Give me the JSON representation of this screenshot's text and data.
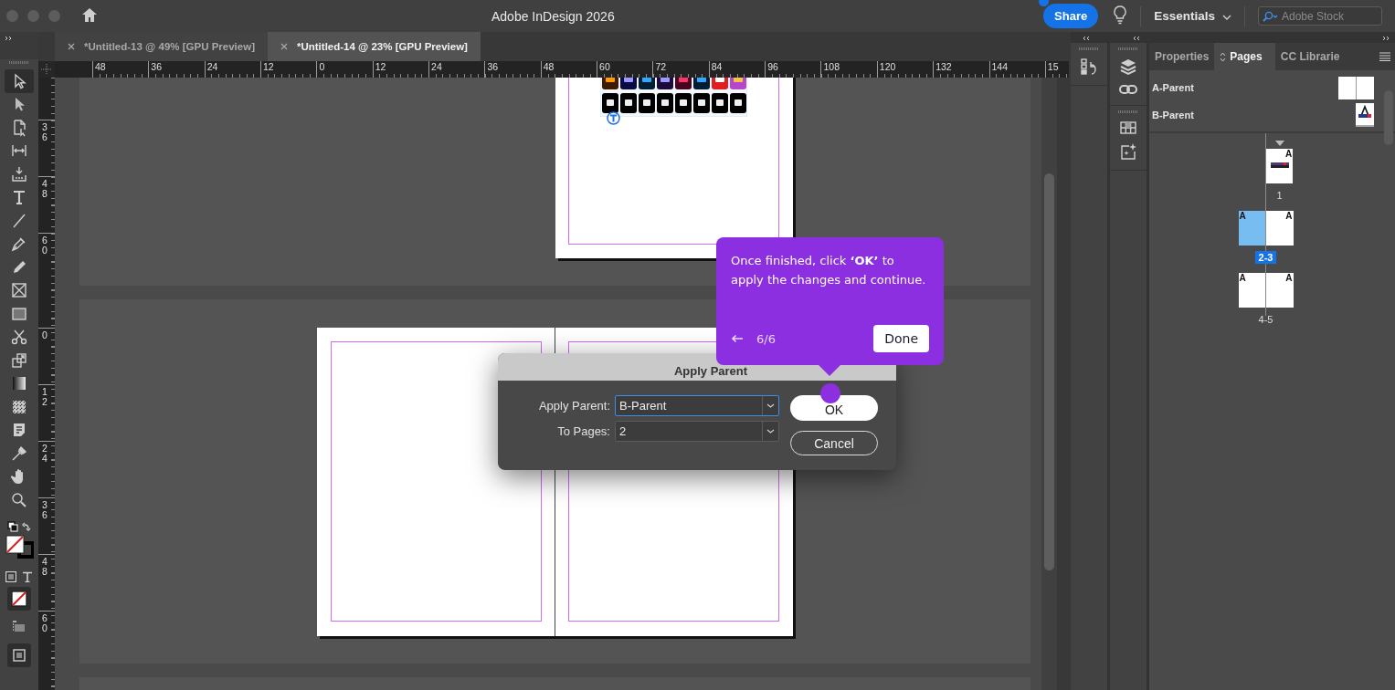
{
  "window": {
    "title": "Adobe InDesign 2026"
  },
  "header": {
    "share": "Share",
    "workspace": "Essentials",
    "search": {
      "placeholder": "Adobe Stock"
    }
  },
  "tools": [
    {
      "kind": "selection",
      "selected": true
    },
    {
      "kind": "direct-selection",
      "selected": false
    },
    {
      "kind": "page",
      "selected": false
    },
    {
      "kind": "gap",
      "selected": false
    },
    {
      "kind": "content-collector",
      "selected": false
    },
    {
      "kind": "type",
      "selected": false
    },
    {
      "kind": "line",
      "selected": false
    },
    {
      "kind": "pen",
      "selected": false
    },
    {
      "kind": "pencil",
      "selected": false
    },
    {
      "kind": "rectangle-frame",
      "selected": false
    },
    {
      "kind": "rectangle",
      "selected": false
    },
    {
      "kind": "scissors",
      "selected": false
    },
    {
      "kind": "free-transform",
      "selected": false
    },
    {
      "kind": "gradient-swatch",
      "selected": false
    },
    {
      "kind": "gradient-feather",
      "selected": false
    },
    {
      "kind": "note",
      "selected": false
    },
    {
      "kind": "eyedropper",
      "selected": false
    },
    {
      "kind": "hand",
      "selected": false
    },
    {
      "kind": "zoom",
      "selected": false
    }
  ],
  "document_tabs": [
    {
      "label": "*Untitled-13 @ 49% [GPU Preview]",
      "selected": false
    },
    {
      "label": "*Untitled-14 @ 23% [GPU Preview]",
      "selected": true
    }
  ],
  "ruler": {
    "horizontal": [
      "48",
      "36",
      "24",
      "12",
      "0",
      "12",
      "24",
      "36",
      "48",
      "60",
      "72",
      "84",
      "96",
      "108",
      "120",
      "132",
      "144",
      "15"
    ],
    "vertical": [
      {
        "labels": [
          "36",
          "48",
          "60"
        ]
      },
      {
        "labels": [
          "0",
          "12",
          "24",
          "36",
          "48",
          "60"
        ]
      }
    ]
  },
  "panel": {
    "tabs": [
      {
        "label": "Properties",
        "selected": false
      },
      {
        "label": "Pages",
        "selected": true
      },
      {
        "label": "CC Librarie",
        "selected": false
      }
    ],
    "parents": [
      {
        "name": "A-Parent",
        "kind": "spread"
      },
      {
        "name": "B-Parent",
        "kind": "single"
      }
    ],
    "pages": [
      {
        "label": "1",
        "parents": [
          "A"
        ],
        "kind": "picture",
        "selected": false
      },
      {
        "label": "2-3",
        "parents": [
          "A",
          "A"
        ],
        "kind": "blank",
        "selected": true
      },
      {
        "label": "4-5",
        "parents": [
          "A",
          "A"
        ],
        "kind": "blank",
        "selected": false
      }
    ]
  },
  "dialog": {
    "title": "Apply Parent",
    "fields": [
      {
        "label": "Apply Parent:",
        "value": "B-Parent",
        "focused": true
      },
      {
        "label": "To Pages:",
        "value": "2",
        "focused": false
      }
    ],
    "buttons": [
      {
        "label": "OK",
        "kind": "primary"
      },
      {
        "label": "Cancel",
        "kind": "secondary"
      }
    ]
  },
  "coach_mark": {
    "text": "Once finished, click **‘OK’** to apply the changes and continue.",
    "step": "6/6",
    "button": "Done"
  }
}
